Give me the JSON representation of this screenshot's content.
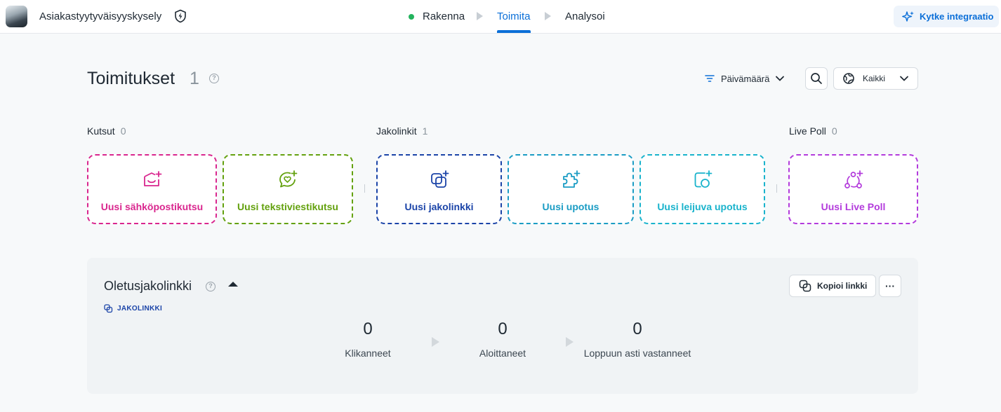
{
  "header": {
    "app_title": "Asiakastyytyväisyyskysely",
    "steps": [
      {
        "label": "Rakenna"
      },
      {
        "label": "Toimita"
      },
      {
        "label": "Analysoi"
      }
    ],
    "integrate_label": "Kytke integraatio"
  },
  "page": {
    "title": "Toimitukset",
    "count": "1",
    "sort_label": "Päivämäärä",
    "filter_label": "Kaikki"
  },
  "sections": [
    {
      "label": "Kutsut",
      "count": "0"
    },
    {
      "label": "Jakolinkit",
      "count": "1"
    },
    {
      "label": "Live Poll",
      "count": "0"
    }
  ],
  "cards": [
    {
      "label": "Uusi sähköpostikutsu",
      "color": "#d9268e"
    },
    {
      "label": "Uusi tekstiviestikutsu",
      "color": "#63a10e"
    },
    {
      "label": "Uusi jakolinkki",
      "color": "#1b44a8"
    },
    {
      "label": "Uusi upotus",
      "color": "#1a9cc4"
    },
    {
      "label": "Uusi leijuva upotus",
      "color": "#19b3cc"
    },
    {
      "label": "Uusi Live Poll",
      "color": "#b33bdc"
    }
  ],
  "panel": {
    "title": "Oletusjakolinkki",
    "badge": "JAKOLINKKI",
    "copy_label": "Kopioi linkki",
    "more_label": "···",
    "stats": [
      {
        "value": "0",
        "label": "Klikanneet"
      },
      {
        "value": "0",
        "label": "Aloittaneet"
      },
      {
        "value": "0",
        "label": "Loppuun asti vastanneet"
      }
    ]
  },
  "colors": {
    "accent": "#0b6fd8",
    "status_green": "#23b35d"
  }
}
